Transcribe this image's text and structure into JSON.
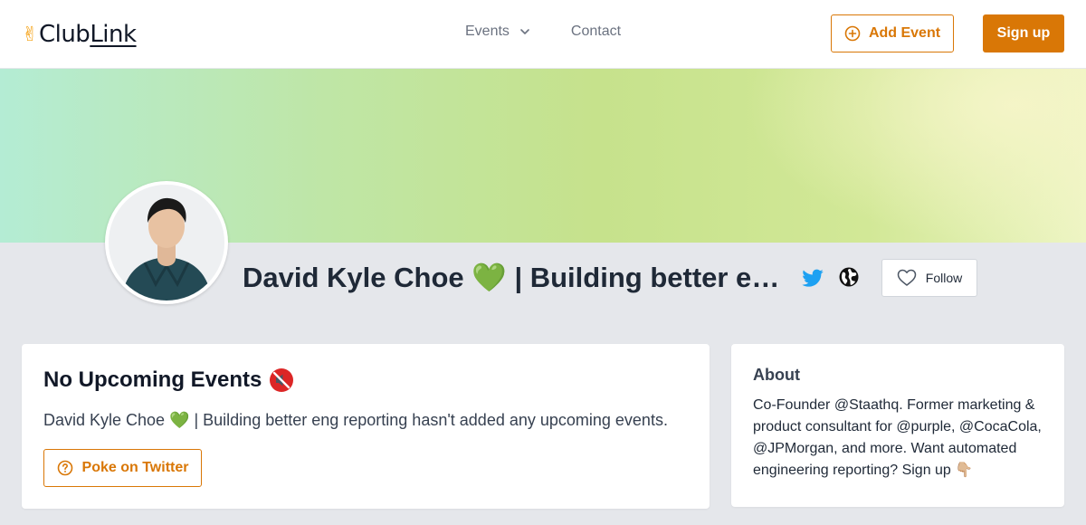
{
  "header": {
    "logo_prefix": "Club",
    "logo_suffix": "Link",
    "logo_emoji": "✌",
    "nav": [
      {
        "label": "Events"
      },
      {
        "label": "Contact"
      }
    ],
    "add_event_label": "Add Event",
    "sign_up_label": "Sign up"
  },
  "profile": {
    "name": "David Kyle Choe 💚 | Building better eng...",
    "follow_label": "Follow"
  },
  "events_card": {
    "title": "No Upcoming Events",
    "description": "David Kyle Choe 💚 | Building better eng reporting hasn't added any upcoming events.",
    "poke_label": "Poke on Twitter"
  },
  "about_card": {
    "title": "About",
    "body": "Co-Founder @Staathq. Former marketing & product consultant for @purple, @CocaCola, @JPMorgan, and more. Want automated engineering reporting? Sign up 👇🏼"
  },
  "colors": {
    "accent": "#d97706",
    "twitter": "#1da1f2",
    "page_bg": "#e5e7eb"
  },
  "icons": {
    "nav_events": "chevron-down-icon",
    "add_event": "plus-circle-icon",
    "twitter": "twitter-icon",
    "website": "globe-icon",
    "follow": "heart-icon",
    "events_title": "muted-speaker-icon",
    "poke": "question-circle-icon"
  }
}
